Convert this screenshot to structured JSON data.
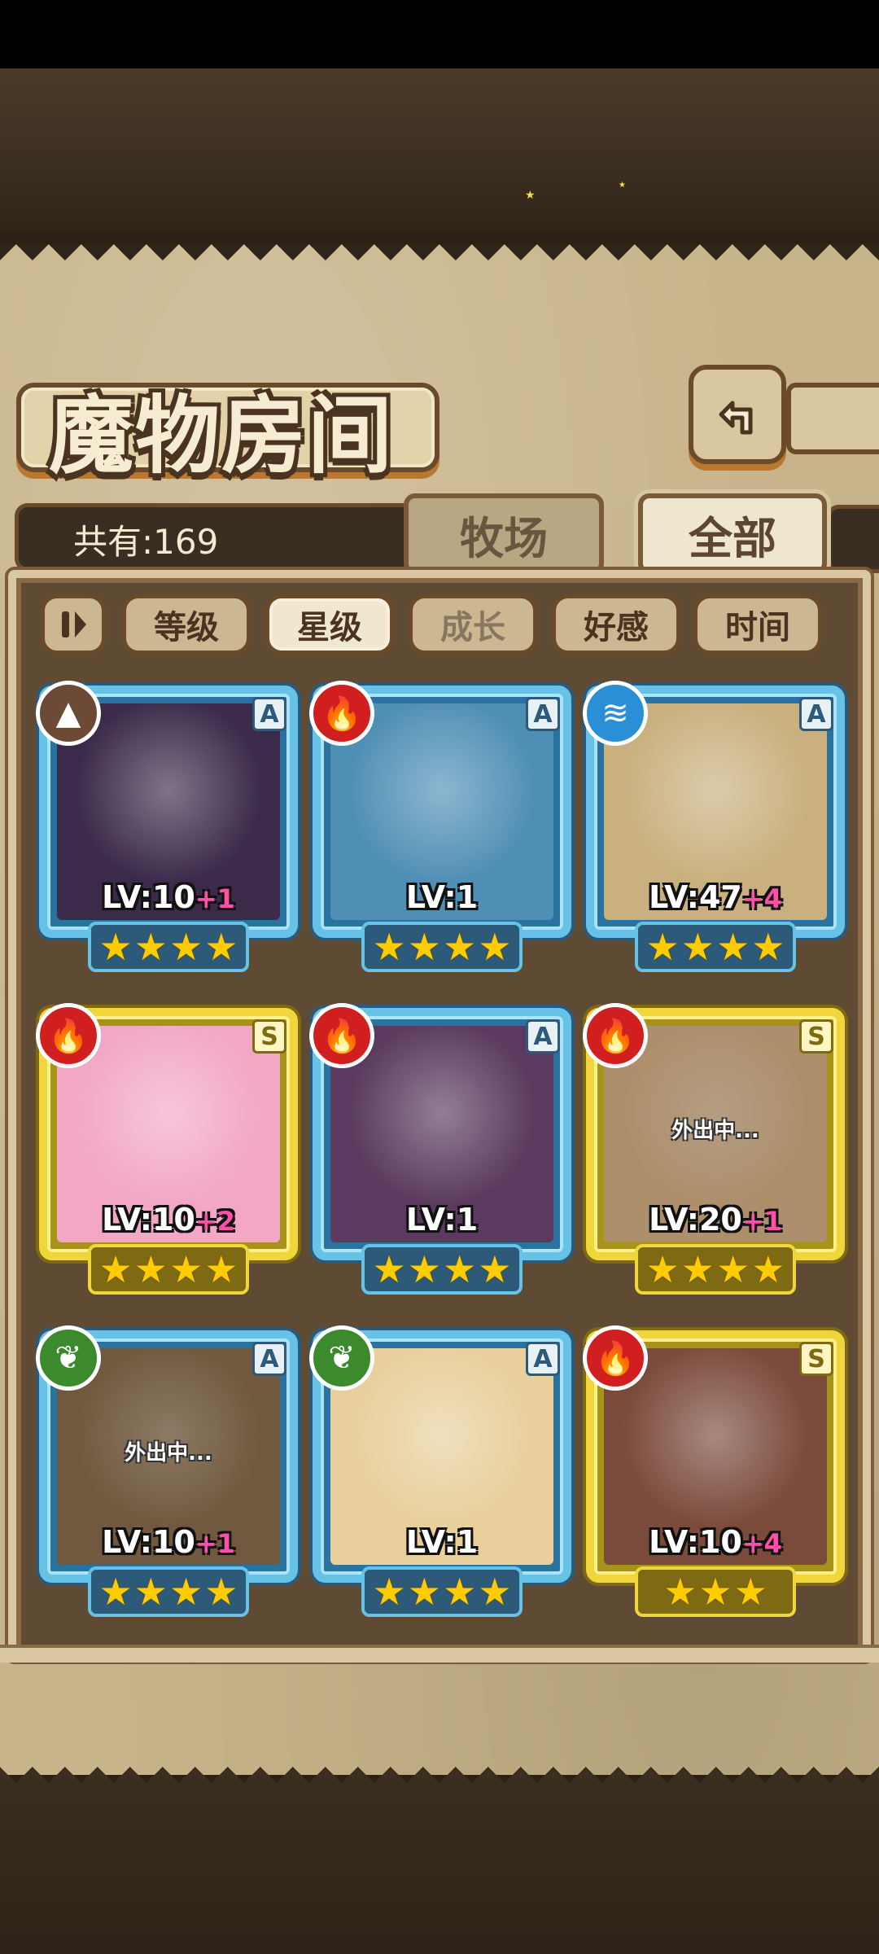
{
  "header": {
    "title": "魔物房间",
    "back_icon": "return-arrow-icon"
  },
  "summary": {
    "count_label": "共有:169"
  },
  "tabs": [
    {
      "label": "牧场",
      "active": false
    },
    {
      "label": "全部",
      "active": true
    }
  ],
  "sort": {
    "toggle_icon": "pause-sort-icon",
    "buttons": [
      {
        "label": "等级",
        "state": "normal"
      },
      {
        "label": "星级",
        "state": "active"
      },
      {
        "label": "成长",
        "state": "dim"
      },
      {
        "label": "好感",
        "state": "normal"
      },
      {
        "label": "时间",
        "state": "normal"
      }
    ]
  },
  "monsters": [
    {
      "element": "earth",
      "rank": "A",
      "level": "LV:10",
      "plus": "+1",
      "stars": 4,
      "away": false,
      "away_text": "",
      "portrait_color": "#3b2a4a"
    },
    {
      "element": "fire",
      "rank": "A",
      "level": "LV:1",
      "plus": "",
      "stars": 4,
      "away": false,
      "away_text": "",
      "portrait_color": "#4f8fb5"
    },
    {
      "element": "water",
      "rank": "A",
      "level": "LV:47",
      "plus": "+4",
      "stars": 4,
      "away": false,
      "away_text": "",
      "portrait_color": "#c9b07e"
    },
    {
      "element": "fire",
      "rank": "S",
      "level": "LV:10",
      "plus": "+2",
      "stars": 4,
      "away": false,
      "away_text": "",
      "portrait_color": "#f2a7c6"
    },
    {
      "element": "fire",
      "rank": "A",
      "level": "LV:1",
      "plus": "",
      "stars": 4,
      "away": false,
      "away_text": "",
      "portrait_color": "#5a3a5e"
    },
    {
      "element": "fire",
      "rank": "S",
      "level": "LV:20",
      "plus": "+1",
      "stars": 4,
      "away": true,
      "away_text": "外出中...",
      "portrait_color": "#d9b28a"
    },
    {
      "element": "wood",
      "rank": "A",
      "level": "LV:10",
      "plus": "+1",
      "stars": 4,
      "away": true,
      "away_text": "外出中...",
      "portrait_color": "#6a5038"
    },
    {
      "element": "wood",
      "rank": "A",
      "level": "LV:1",
      "plus": "",
      "stars": 4,
      "away": false,
      "away_text": "",
      "portrait_color": "#e8cf9b"
    },
    {
      "element": "fire",
      "rank": "S",
      "level": "LV:10",
      "plus": "+4",
      "stars": 3,
      "away": false,
      "away_text": "",
      "portrait_color": "#7a4a3a"
    }
  ]
}
